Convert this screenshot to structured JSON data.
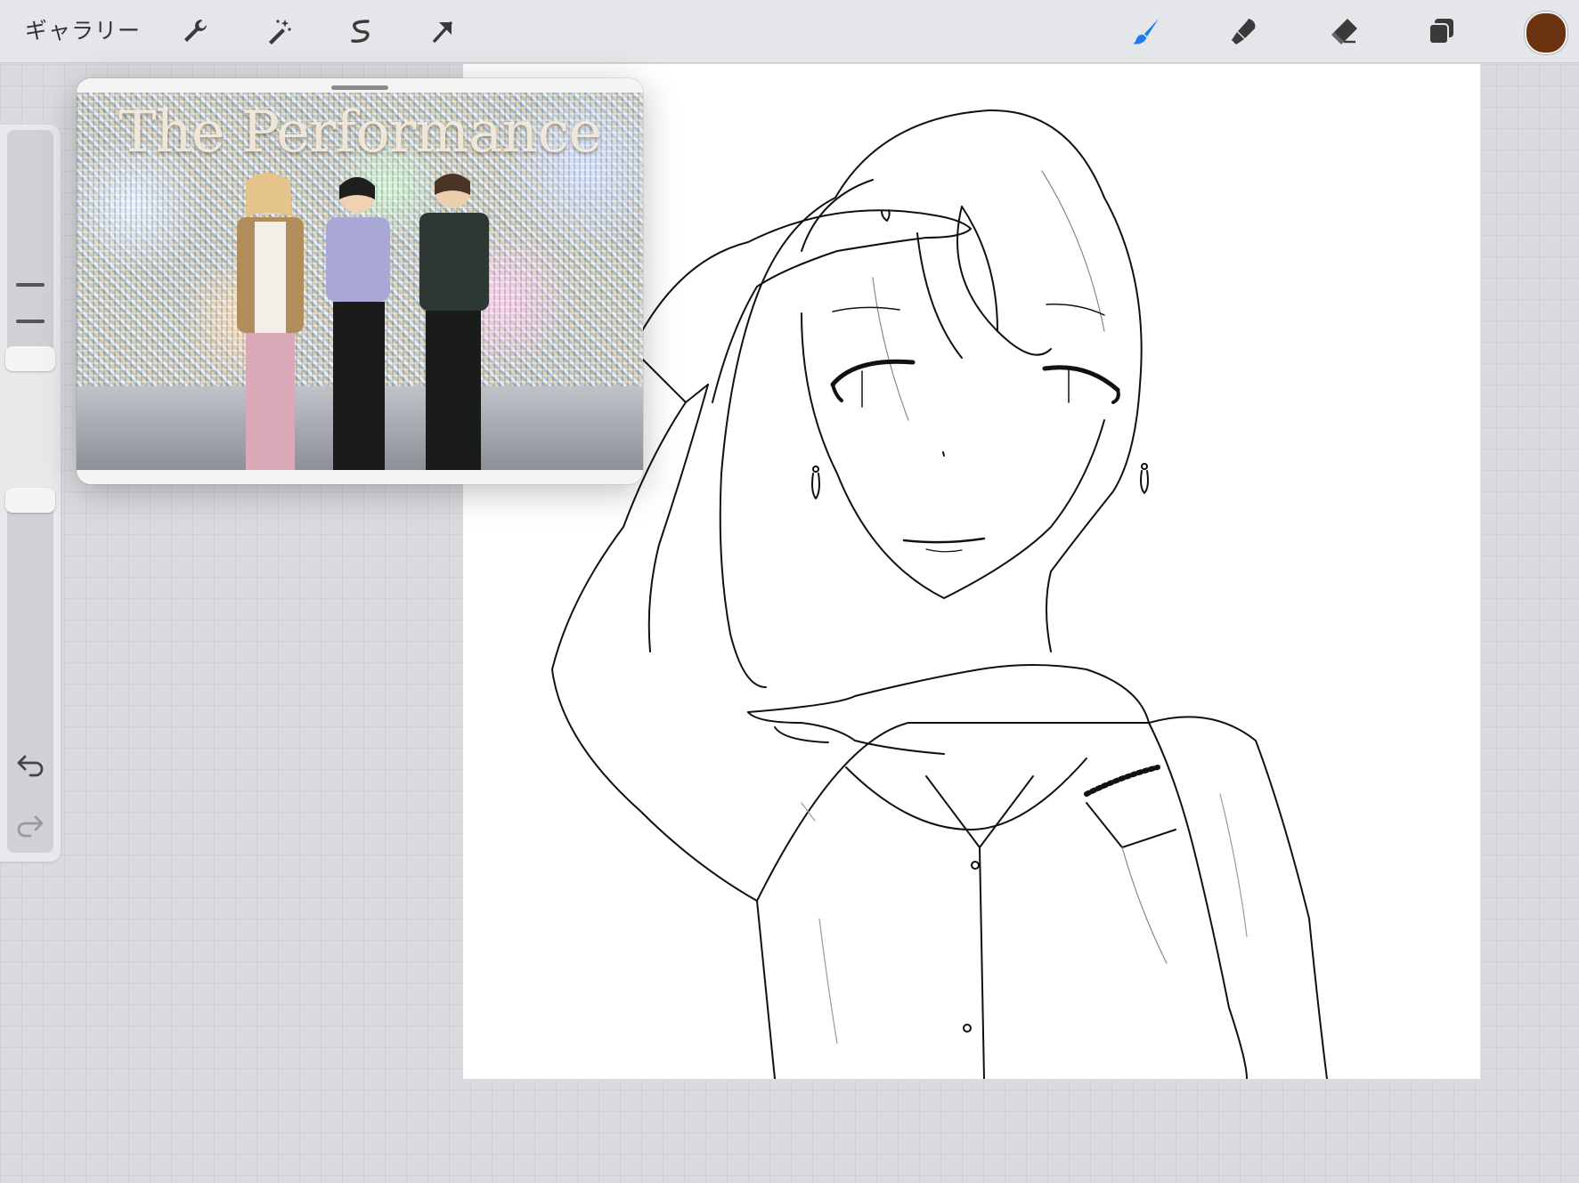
{
  "toolbar": {
    "gallery_label": "ギャラリー",
    "left_tools": [
      {
        "name": "actions",
        "icon": "wrench-icon"
      },
      {
        "name": "adjustments",
        "icon": "magic-wand-icon"
      },
      {
        "name": "selection",
        "icon": "selection-s-icon"
      },
      {
        "name": "transform",
        "icon": "arrow-cursor-icon"
      }
    ],
    "right_tools": [
      {
        "name": "brush",
        "icon": "brush-icon",
        "active": true,
        "color": "#1e7bf0"
      },
      {
        "name": "smudge",
        "icon": "smudge-icon"
      },
      {
        "name": "eraser",
        "icon": "eraser-icon"
      },
      {
        "name": "layers",
        "icon": "layers-icon"
      }
    ],
    "current_color": "#6b3310"
  },
  "sidebar": {
    "brush_size_level": 0.22,
    "opacity_level": 1.0,
    "modifier_icon": "square-modifier-icon",
    "undo_icon": "undo-icon",
    "redo_icon": "redo-icon"
  },
  "reference": {
    "photo_title_text": "The Performance"
  },
  "canvas": {
    "background": "#ffffff",
    "line_color": "#111111"
  }
}
